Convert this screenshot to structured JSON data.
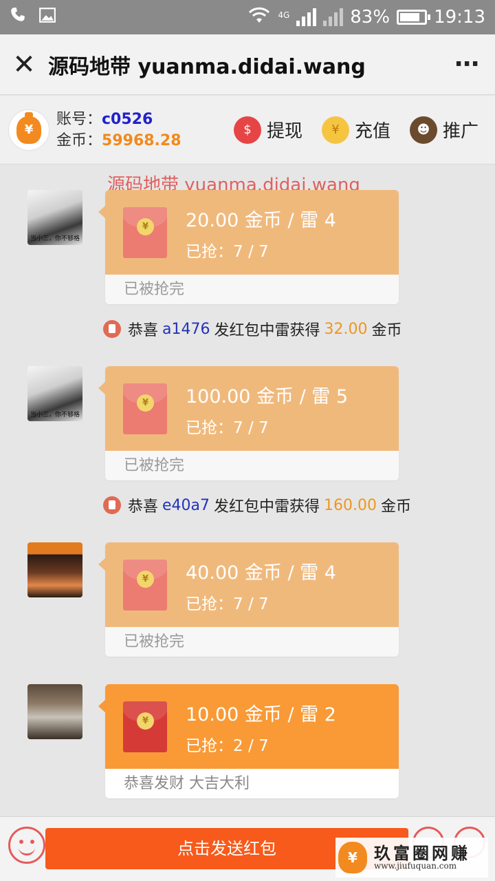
{
  "status_bar": {
    "network": "4G",
    "battery": "83%",
    "battery_fraction": 0.83,
    "time": "19:13"
  },
  "nav": {
    "title": "源码地带 yuanma.didai.wang",
    "close_icon": "close-icon",
    "more_icon": "more-icon",
    "close_glyph": "✕",
    "more_glyph": "⋯"
  },
  "account": {
    "id_label": "账号：",
    "id_value": "c0526",
    "coins_label": "金币：",
    "coins_value": "59968.28",
    "bag_glyph": "¥",
    "actions": [
      {
        "label": "提现",
        "icon": "coins-stack-icon",
        "glyph": "$"
      },
      {
        "label": "充值",
        "icon": "coin-hand-icon",
        "glyph": "¥"
      },
      {
        "label": "推广",
        "icon": "promoter-icon",
        "glyph": "☻"
      }
    ]
  },
  "watermark": "源码地带 yuanma.didai.wang",
  "messages": [
    {
      "amount": "20.00 金币 / 雷 4",
      "grabbed": "已抢：7 / 7",
      "status": "已被抢完",
      "avatar_caption": "当小三，你不够格"
    },
    {
      "amount": "100.00 金币 / 雷 5",
      "grabbed": "已抢：7 / 7",
      "status": "已被抢完",
      "avatar_caption": "当小三，你不够格"
    },
    {
      "amount": "40.00 金币 / 雷 4",
      "grabbed": "已抢：7 / 7",
      "status": "已被抢完"
    },
    {
      "amount": "10.00 金币 / 雷 2",
      "grabbed": "已抢：2 / 7",
      "status": "恭喜发财 大吉大利"
    }
  ],
  "notices": [
    {
      "prefix": "恭喜",
      "user": "a1476",
      "middle": "发红包中雷获得",
      "amount": "32.00",
      "suffix": "金币"
    },
    {
      "prefix": "恭喜",
      "user": "e40a7",
      "middle": "发红包中雷获得",
      "amount": "160.00",
      "suffix": "金币"
    }
  ],
  "coin_glyph": "¥",
  "bottom": {
    "send_label": "点击发送红包",
    "ad_title": "玖富圈网赚",
    "ad_url": "www.jiufuquan.com",
    "ad_glyph": "¥"
  },
  "colors": {
    "accent_orange": "#f99a36",
    "grabbed_orange": "#f0b97c",
    "send_button": "#f75a1b",
    "user_id_blue": "#2222cc",
    "coin_amount": "#f08a1c"
  }
}
